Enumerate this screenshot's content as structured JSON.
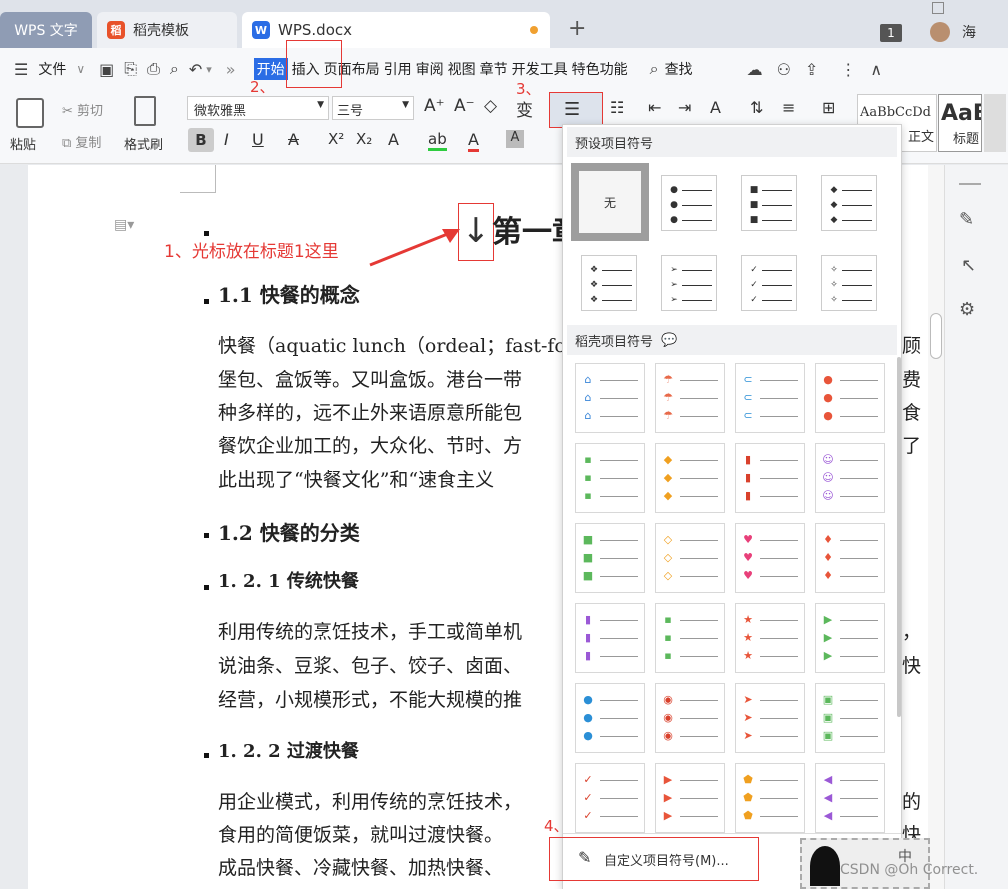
{
  "tabs": {
    "wps": "WPS 文字",
    "template": "稻壳模板",
    "doc": "WPS.docx",
    "add": "+"
  },
  "title_right": {
    "badge": "1",
    "user": "海"
  },
  "menu": {
    "file": "文件",
    "items": [
      "开始",
      "插入",
      "页面布局",
      "引用",
      "审阅",
      "视图",
      "章节",
      "开发工具",
      "特色功能"
    ],
    "search": "查找"
  },
  "ribbon": {
    "paste": "粘贴",
    "cut": "剪切",
    "copy": "复制",
    "format_painter": "格式刷",
    "font": "微软雅黑",
    "size": "三号",
    "style1": "AaBbCcDd",
    "style1_label": "正文",
    "style2": "AaB",
    "style2_label": "标题"
  },
  "annotations": {
    "step1": "1、光标放在标题1这里",
    "step2": "2、",
    "step3": "3、",
    "step4": "4、"
  },
  "doc": {
    "h1": "第一章",
    "h2_1": "1.1 快餐的概念",
    "p1": [
      "快餐（aquatic lunch（ordeal；fast-fo",
      "堡包、盒饭等。又叫盒饭。港台一带",
      "种多样的，远不止外来语原意所能包",
      "餐饮企业加工的，大众化、节时、方",
      "此出现了“快餐文化”和“速食主义"
    ],
    "p1_right": [
      "顾",
      "费",
      "食",
      "了"
    ],
    "h2_2": "1.2  快餐的分类",
    "h3_1": "1. 2. 1  传统快餐",
    "p2": [
      "利用传统的烹饪技术，手工或简单机",
      "说油条、豆浆、包子、饺子、卤面、",
      "经营，小规模形式，不能大规模的推"
    ],
    "p2_right": [
      "，",
      "快"
    ],
    "h3_2": "1. 2. 2  过渡快餐",
    "p3": [
      "用企业模式，利用传统的烹饪技术，",
      "食用的简便饭菜，就叫过渡快餐。",
      "成品快餐、冷藏快餐、加热快餐、"
    ],
    "p3_right": [
      "的",
      "快"
    ]
  },
  "dropdown": {
    "preset_title": "预设项目符号",
    "none_label": "无",
    "daoke_title": "稻壳项目符号",
    "custom": "自定义项目符号(M)..."
  },
  "watermark": "CSDN @Oh Correct.",
  "ime": "中",
  "colors": {
    "accent": "#2b6de5",
    "red": "#e53935"
  }
}
